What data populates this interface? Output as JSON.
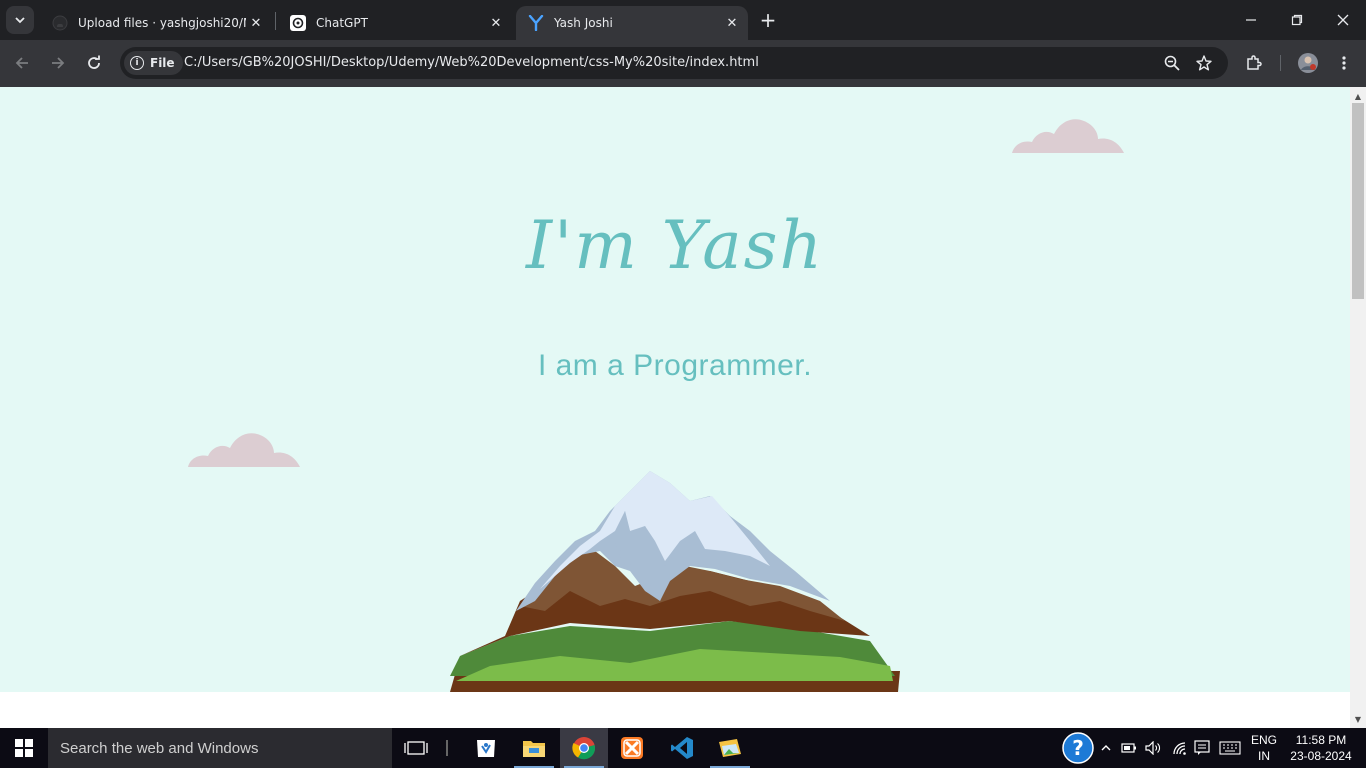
{
  "browser": {
    "tabs": [
      {
        "title": "Upload files · yashgjoshi20/My-",
        "favicon": "github-icon"
      },
      {
        "title": "ChatGPT",
        "favicon": "chatgpt-icon"
      },
      {
        "title": "Yash Joshi",
        "favicon": "y-icon",
        "active": true
      }
    ],
    "address": {
      "chip_label": "File",
      "url": "C:/Users/GB%20JOSHI/Desktop/Udemy/Web%20Development/css-My%20site/index.html"
    }
  },
  "page": {
    "hero_title": "I'm Yash",
    "hero_subtitle": "I am a Programmer.",
    "colors": {
      "background": "#e4f9f5",
      "accent": "#66bfbf",
      "cloud": "#dccdd2"
    }
  },
  "taskbar": {
    "search_placeholder": "Search the web and Windows",
    "lang_line1": "ENG",
    "lang_line2": "IN",
    "time": "11:58 PM",
    "date": "23-08-2024"
  }
}
